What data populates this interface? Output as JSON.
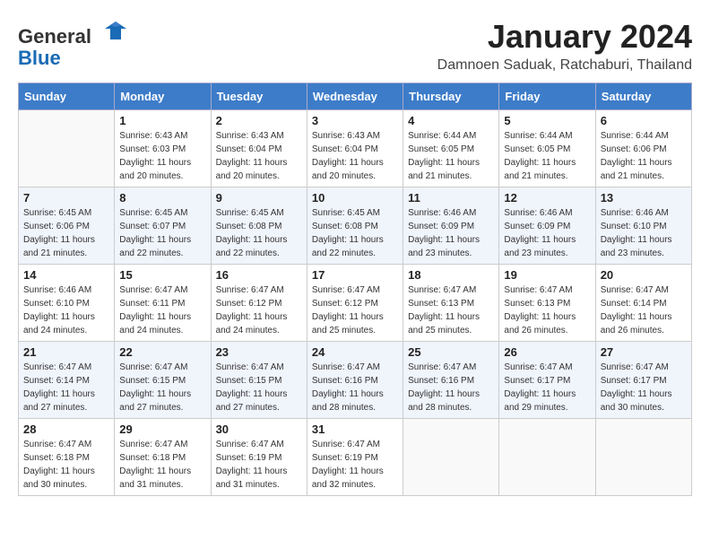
{
  "header": {
    "logo_general": "General",
    "logo_blue": "Blue",
    "month_year": "January 2024",
    "location": "Damnoen Saduak, Ratchaburi, Thailand"
  },
  "days_of_week": [
    "Sunday",
    "Monday",
    "Tuesday",
    "Wednesday",
    "Thursday",
    "Friday",
    "Saturday"
  ],
  "weeks": [
    [
      {
        "day": "",
        "empty": true
      },
      {
        "day": "1",
        "sunrise": "Sunrise: 6:43 AM",
        "sunset": "Sunset: 6:03 PM",
        "daylight": "Daylight: 11 hours and 20 minutes."
      },
      {
        "day": "2",
        "sunrise": "Sunrise: 6:43 AM",
        "sunset": "Sunset: 6:04 PM",
        "daylight": "Daylight: 11 hours and 20 minutes."
      },
      {
        "day": "3",
        "sunrise": "Sunrise: 6:43 AM",
        "sunset": "Sunset: 6:04 PM",
        "daylight": "Daylight: 11 hours and 20 minutes."
      },
      {
        "day": "4",
        "sunrise": "Sunrise: 6:44 AM",
        "sunset": "Sunset: 6:05 PM",
        "daylight": "Daylight: 11 hours and 21 minutes."
      },
      {
        "day": "5",
        "sunrise": "Sunrise: 6:44 AM",
        "sunset": "Sunset: 6:05 PM",
        "daylight": "Daylight: 11 hours and 21 minutes."
      },
      {
        "day": "6",
        "sunrise": "Sunrise: 6:44 AM",
        "sunset": "Sunset: 6:06 PM",
        "daylight": "Daylight: 11 hours and 21 minutes."
      }
    ],
    [
      {
        "day": "7",
        "sunrise": "Sunrise: 6:45 AM",
        "sunset": "Sunset: 6:06 PM",
        "daylight": "Daylight: 11 hours and 21 minutes."
      },
      {
        "day": "8",
        "sunrise": "Sunrise: 6:45 AM",
        "sunset": "Sunset: 6:07 PM",
        "daylight": "Daylight: 11 hours and 22 minutes."
      },
      {
        "day": "9",
        "sunrise": "Sunrise: 6:45 AM",
        "sunset": "Sunset: 6:08 PM",
        "daylight": "Daylight: 11 hours and 22 minutes."
      },
      {
        "day": "10",
        "sunrise": "Sunrise: 6:45 AM",
        "sunset": "Sunset: 6:08 PM",
        "daylight": "Daylight: 11 hours and 22 minutes."
      },
      {
        "day": "11",
        "sunrise": "Sunrise: 6:46 AM",
        "sunset": "Sunset: 6:09 PM",
        "daylight": "Daylight: 11 hours and 23 minutes."
      },
      {
        "day": "12",
        "sunrise": "Sunrise: 6:46 AM",
        "sunset": "Sunset: 6:09 PM",
        "daylight": "Daylight: 11 hours and 23 minutes."
      },
      {
        "day": "13",
        "sunrise": "Sunrise: 6:46 AM",
        "sunset": "Sunset: 6:10 PM",
        "daylight": "Daylight: 11 hours and 23 minutes."
      }
    ],
    [
      {
        "day": "14",
        "sunrise": "Sunrise: 6:46 AM",
        "sunset": "Sunset: 6:10 PM",
        "daylight": "Daylight: 11 hours and 24 minutes."
      },
      {
        "day": "15",
        "sunrise": "Sunrise: 6:47 AM",
        "sunset": "Sunset: 6:11 PM",
        "daylight": "Daylight: 11 hours and 24 minutes."
      },
      {
        "day": "16",
        "sunrise": "Sunrise: 6:47 AM",
        "sunset": "Sunset: 6:12 PM",
        "daylight": "Daylight: 11 hours and 24 minutes."
      },
      {
        "day": "17",
        "sunrise": "Sunrise: 6:47 AM",
        "sunset": "Sunset: 6:12 PM",
        "daylight": "Daylight: 11 hours and 25 minutes."
      },
      {
        "day": "18",
        "sunrise": "Sunrise: 6:47 AM",
        "sunset": "Sunset: 6:13 PM",
        "daylight": "Daylight: 11 hours and 25 minutes."
      },
      {
        "day": "19",
        "sunrise": "Sunrise: 6:47 AM",
        "sunset": "Sunset: 6:13 PM",
        "daylight": "Daylight: 11 hours and 26 minutes."
      },
      {
        "day": "20",
        "sunrise": "Sunrise: 6:47 AM",
        "sunset": "Sunset: 6:14 PM",
        "daylight": "Daylight: 11 hours and 26 minutes."
      }
    ],
    [
      {
        "day": "21",
        "sunrise": "Sunrise: 6:47 AM",
        "sunset": "Sunset: 6:14 PM",
        "daylight": "Daylight: 11 hours and 27 minutes."
      },
      {
        "day": "22",
        "sunrise": "Sunrise: 6:47 AM",
        "sunset": "Sunset: 6:15 PM",
        "daylight": "Daylight: 11 hours and 27 minutes."
      },
      {
        "day": "23",
        "sunrise": "Sunrise: 6:47 AM",
        "sunset": "Sunset: 6:15 PM",
        "daylight": "Daylight: 11 hours and 27 minutes."
      },
      {
        "day": "24",
        "sunrise": "Sunrise: 6:47 AM",
        "sunset": "Sunset: 6:16 PM",
        "daylight": "Daylight: 11 hours and 28 minutes."
      },
      {
        "day": "25",
        "sunrise": "Sunrise: 6:47 AM",
        "sunset": "Sunset: 6:16 PM",
        "daylight": "Daylight: 11 hours and 28 minutes."
      },
      {
        "day": "26",
        "sunrise": "Sunrise: 6:47 AM",
        "sunset": "Sunset: 6:17 PM",
        "daylight": "Daylight: 11 hours and 29 minutes."
      },
      {
        "day": "27",
        "sunrise": "Sunrise: 6:47 AM",
        "sunset": "Sunset: 6:17 PM",
        "daylight": "Daylight: 11 hours and 30 minutes."
      }
    ],
    [
      {
        "day": "28",
        "sunrise": "Sunrise: 6:47 AM",
        "sunset": "Sunset: 6:18 PM",
        "daylight": "Daylight: 11 hours and 30 minutes."
      },
      {
        "day": "29",
        "sunrise": "Sunrise: 6:47 AM",
        "sunset": "Sunset: 6:18 PM",
        "daylight": "Daylight: 11 hours and 31 minutes."
      },
      {
        "day": "30",
        "sunrise": "Sunrise: 6:47 AM",
        "sunset": "Sunset: 6:19 PM",
        "daylight": "Daylight: 11 hours and 31 minutes."
      },
      {
        "day": "31",
        "sunrise": "Sunrise: 6:47 AM",
        "sunset": "Sunset: 6:19 PM",
        "daylight": "Daylight: 11 hours and 32 minutes."
      },
      {
        "day": "",
        "empty": true
      },
      {
        "day": "",
        "empty": true
      },
      {
        "day": "",
        "empty": true
      }
    ]
  ]
}
